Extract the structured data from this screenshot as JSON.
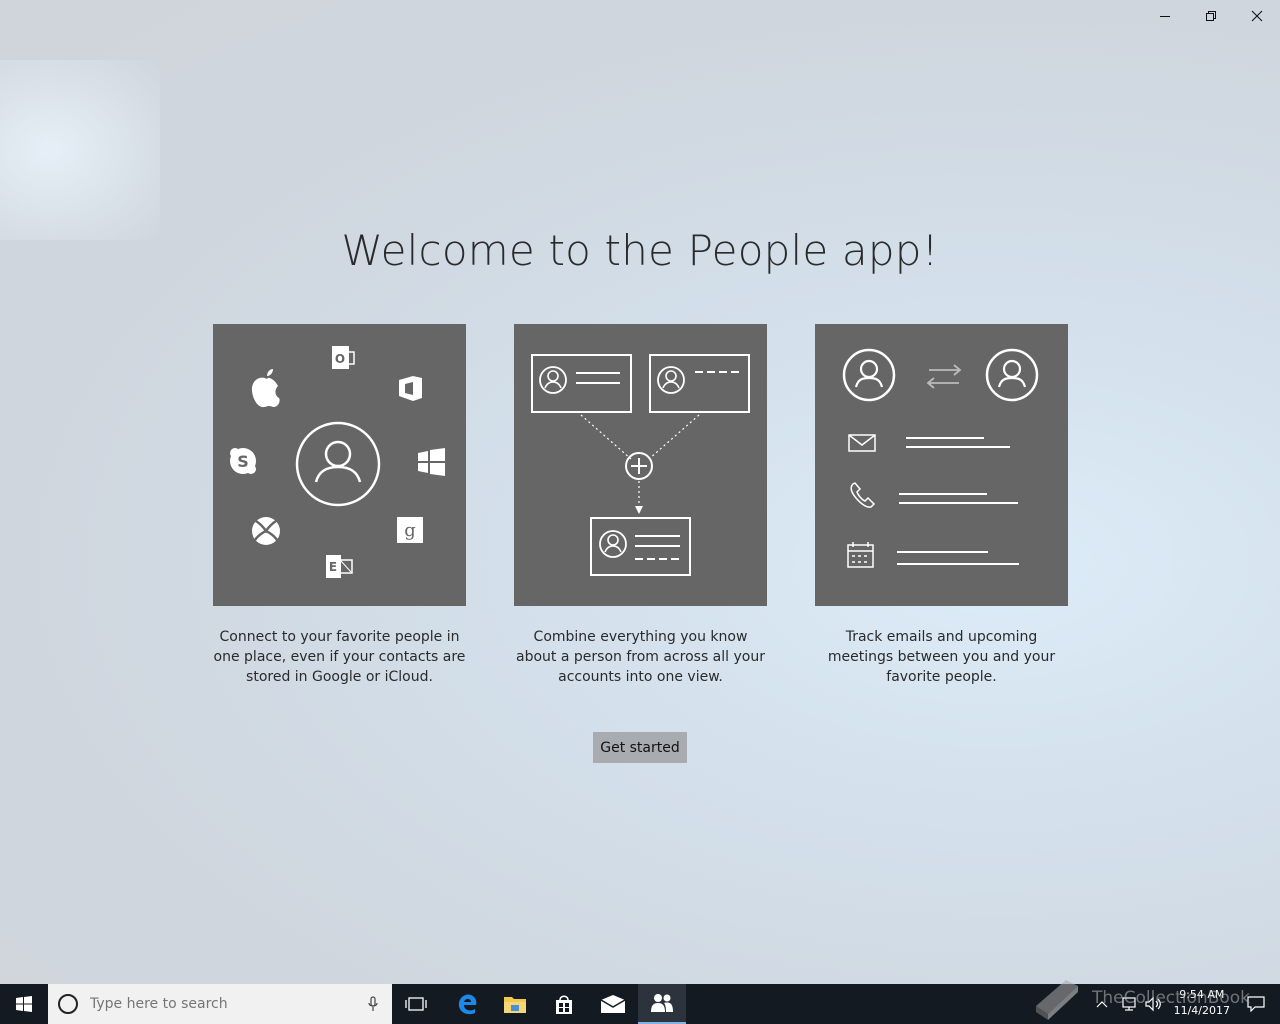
{
  "window": {
    "minimize_icon": "minimize-icon",
    "restore_icon": "restore-icon",
    "close_icon": "close-icon"
  },
  "welcome": {
    "title": "Welcome to the People app!",
    "cards": [
      {
        "description": "Connect to your favorite people in one place, even if your contacts are stored in Google or iCloud.",
        "icons": [
          "person-icon",
          "outlook-icon",
          "office-icon",
          "windows-icon",
          "google-icon",
          "exchange-icon",
          "xbox-icon",
          "skype-icon",
          "apple-icon"
        ]
      },
      {
        "description": "Combine everything you know about a person from across all your accounts into one view.",
        "icons": [
          "contact-card-icon",
          "plus-icon",
          "merged-contact-card-icon"
        ]
      },
      {
        "description": "Track emails and upcoming meetings between you and your favorite people.",
        "icons": [
          "person-icon",
          "exchange-arrows-icon",
          "mail-icon",
          "phone-icon",
          "calendar-icon"
        ]
      }
    ],
    "get_started_label": "Get started"
  },
  "taskbar": {
    "search_placeholder": "Type here to search",
    "apps": [
      "start-icon",
      "cortana-icon",
      "microphone-icon",
      "task-view-icon",
      "edge-icon",
      "file-explorer-icon",
      "store-icon",
      "mail-icon",
      "people-icon"
    ],
    "active_app": "people-icon",
    "clock_time": "9:54 AM",
    "clock_date": "11/4/2017",
    "watermark": "TheCollectionBook"
  },
  "colors": {
    "card_bg": "#666666",
    "button_bg": "#a8acb1",
    "taskbar_bg": "#141a22",
    "active_accent": "#7fb2e5"
  }
}
